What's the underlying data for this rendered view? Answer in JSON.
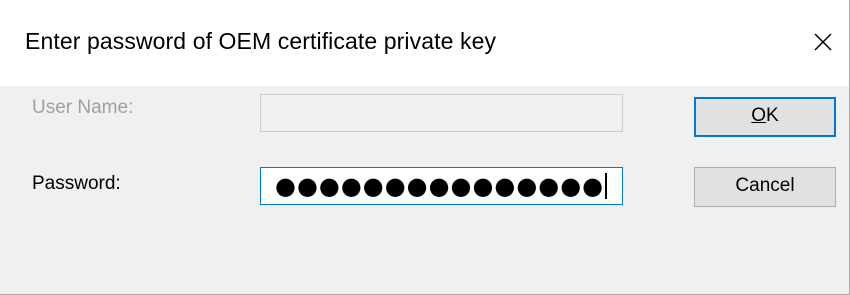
{
  "window": {
    "title": "Enter password of OEM certificate private key",
    "close_icon": "close-icon"
  },
  "form": {
    "username": {
      "label": "User Name:",
      "value": "",
      "enabled": false
    },
    "password": {
      "label": "Password:",
      "masked_value": "●●●●●●●●●●●●●●●",
      "focused": true
    }
  },
  "buttons": {
    "ok_label": "OK",
    "cancel_label": "Cancel"
  },
  "colors": {
    "accent": "#0078d7",
    "dialog_bg": "#f0f0f0",
    "disabled_text": "#a0a0a0"
  }
}
